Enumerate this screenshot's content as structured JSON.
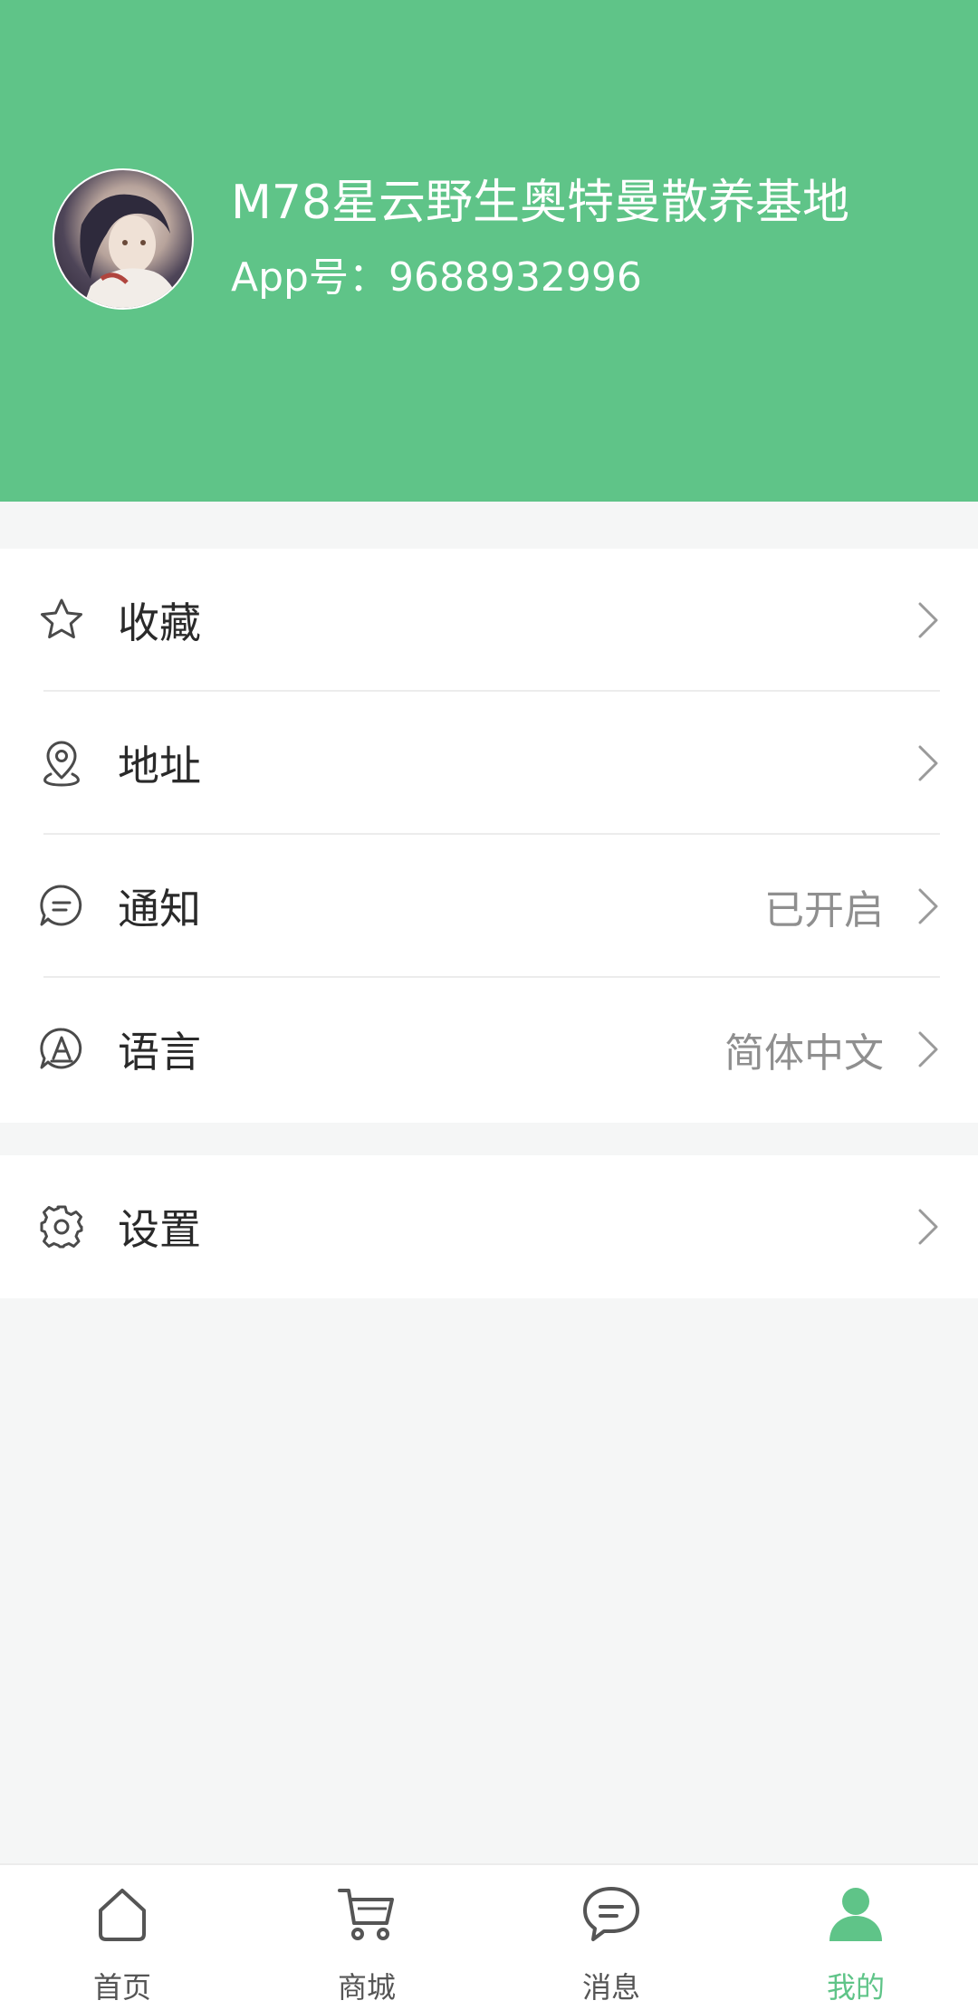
{
  "colors": {
    "accent": "#5fc488",
    "background": "#f5f6f6",
    "value_text": "#8f8f8f"
  },
  "profile": {
    "name": "M78星云野生奥特曼散养基地",
    "app_id_label": "App号：",
    "app_id": "9688932996"
  },
  "menu": {
    "favorites": {
      "label": "收藏",
      "icon": "star-icon"
    },
    "address": {
      "label": "地址",
      "icon": "location-pin-icon"
    },
    "notifications": {
      "label": "通知",
      "value": "已开启",
      "icon": "chat-bubble-icon"
    },
    "language": {
      "label": "语言",
      "value": "简体中文",
      "icon": "language-icon"
    },
    "settings": {
      "label": "设置",
      "icon": "gear-icon"
    }
  },
  "tabbar": {
    "home": {
      "label": "首页",
      "icon": "home-icon"
    },
    "mall": {
      "label": "商城",
      "icon": "cart-icon"
    },
    "messages": {
      "label": "消息",
      "icon": "message-icon"
    },
    "mine": {
      "label": "我的",
      "icon": "user-icon",
      "active": true
    }
  }
}
